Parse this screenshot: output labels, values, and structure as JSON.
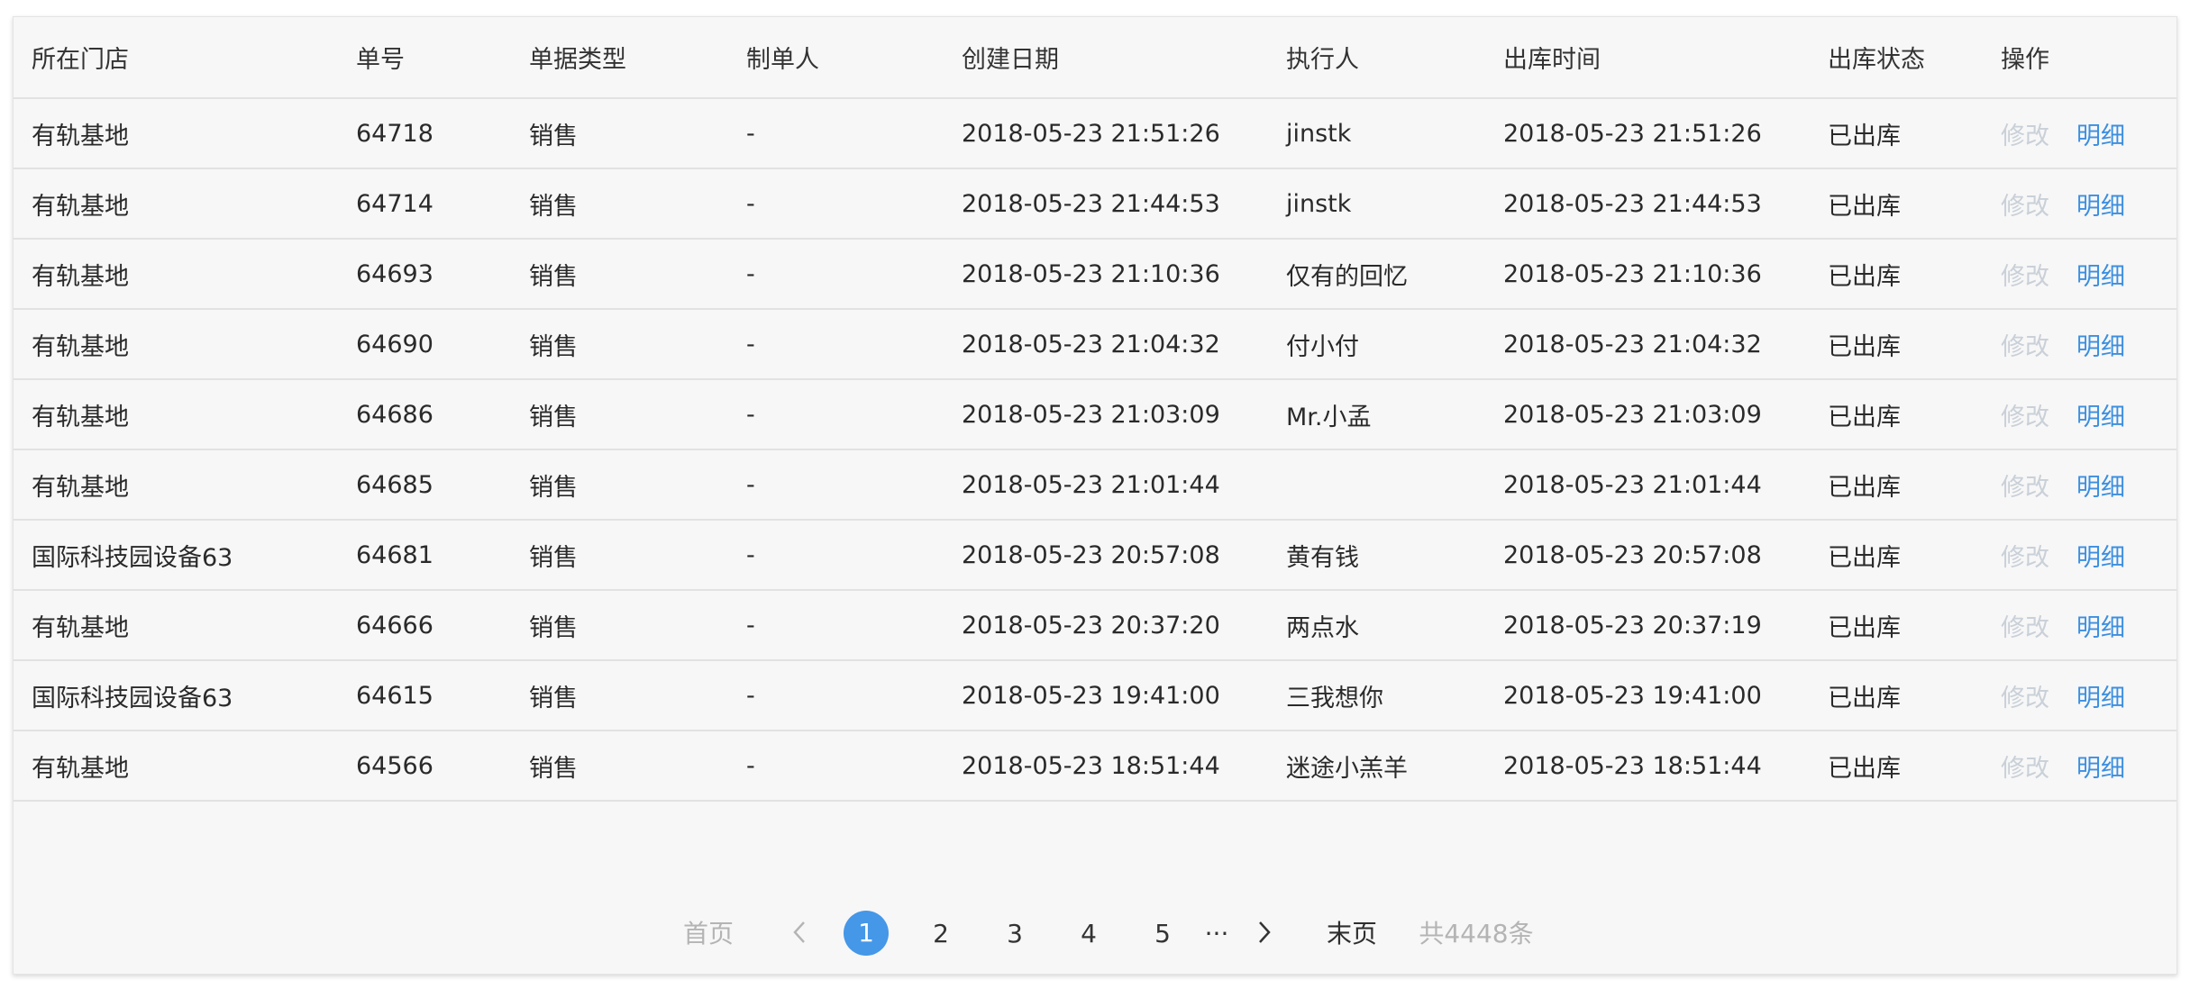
{
  "table": {
    "columns": [
      "所在门店",
      "单号",
      "单据类型",
      "制单人",
      "创建日期",
      "执行人",
      "出库时间",
      "出库状态",
      "操作"
    ],
    "rows": [
      {
        "store": "有轨基地",
        "no": "64718",
        "type": "销售",
        "maker": "-",
        "created": "2018-05-23 21:51:26",
        "executor": "jinstk",
        "out_time": "2018-05-23 21:51:26",
        "status": "已出库"
      },
      {
        "store": "有轨基地",
        "no": "64714",
        "type": "销售",
        "maker": "-",
        "created": "2018-05-23 21:44:53",
        "executor": "jinstk",
        "out_time": "2018-05-23 21:44:53",
        "status": "已出库"
      },
      {
        "store": "有轨基地",
        "no": "64693",
        "type": "销售",
        "maker": "-",
        "created": "2018-05-23 21:10:36",
        "executor": "仅有的回忆",
        "out_time": "2018-05-23 21:10:36",
        "status": "已出库"
      },
      {
        "store": "有轨基地",
        "no": "64690",
        "type": "销售",
        "maker": "-",
        "created": "2018-05-23 21:04:32",
        "executor": "付小付",
        "out_time": "2018-05-23 21:04:32",
        "status": "已出库"
      },
      {
        "store": "有轨基地",
        "no": "64686",
        "type": "销售",
        "maker": "-",
        "created": "2018-05-23 21:03:09",
        "executor": "Mr.小孟",
        "out_time": "2018-05-23 21:03:09",
        "status": "已出库"
      },
      {
        "store": "有轨基地",
        "no": "64685",
        "type": "销售",
        "maker": "-",
        "created": "2018-05-23 21:01:44",
        "executor": "",
        "out_time": "2018-05-23 21:01:44",
        "status": "已出库"
      },
      {
        "store": "国际科技园设备63",
        "no": "64681",
        "type": "销售",
        "maker": "-",
        "created": "2018-05-23 20:57:08",
        "executor": "黄有钱",
        "out_time": "2018-05-23 20:57:08",
        "status": "已出库"
      },
      {
        "store": "有轨基地",
        "no": "64666",
        "type": "销售",
        "maker": "-",
        "created": "2018-05-23 20:37:20",
        "executor": "两点水",
        "out_time": "2018-05-23 20:37:19",
        "status": "已出库"
      },
      {
        "store": "国际科技园设备63",
        "no": "64615",
        "type": "销售",
        "maker": "-",
        "created": "2018-05-23 19:41:00",
        "executor": "三我想你",
        "out_time": "2018-05-23 19:41:00",
        "status": "已出库"
      },
      {
        "store": "有轨基地",
        "no": "64566",
        "type": "销售",
        "maker": "-",
        "created": "2018-05-23 18:51:44",
        "executor": "迷途小羔羊",
        "out_time": "2018-05-23 18:51:44",
        "status": "已出库"
      }
    ],
    "actions": {
      "edit": "修改",
      "detail": "明细"
    }
  },
  "pagination": {
    "first": "首页",
    "pages": [
      "1",
      "2",
      "3",
      "4",
      "5"
    ],
    "current_page": "1",
    "ellipsis": "···",
    "last": "末页",
    "total": "共4448条",
    "prev_icon": "chevron-left-icon",
    "next_icon": "chevron-right-icon"
  },
  "colors": {
    "accent": "#4597e8",
    "link": "#3c8fe0",
    "disabled": "#c9d0d8",
    "panel_background": "#f7f7f7"
  }
}
